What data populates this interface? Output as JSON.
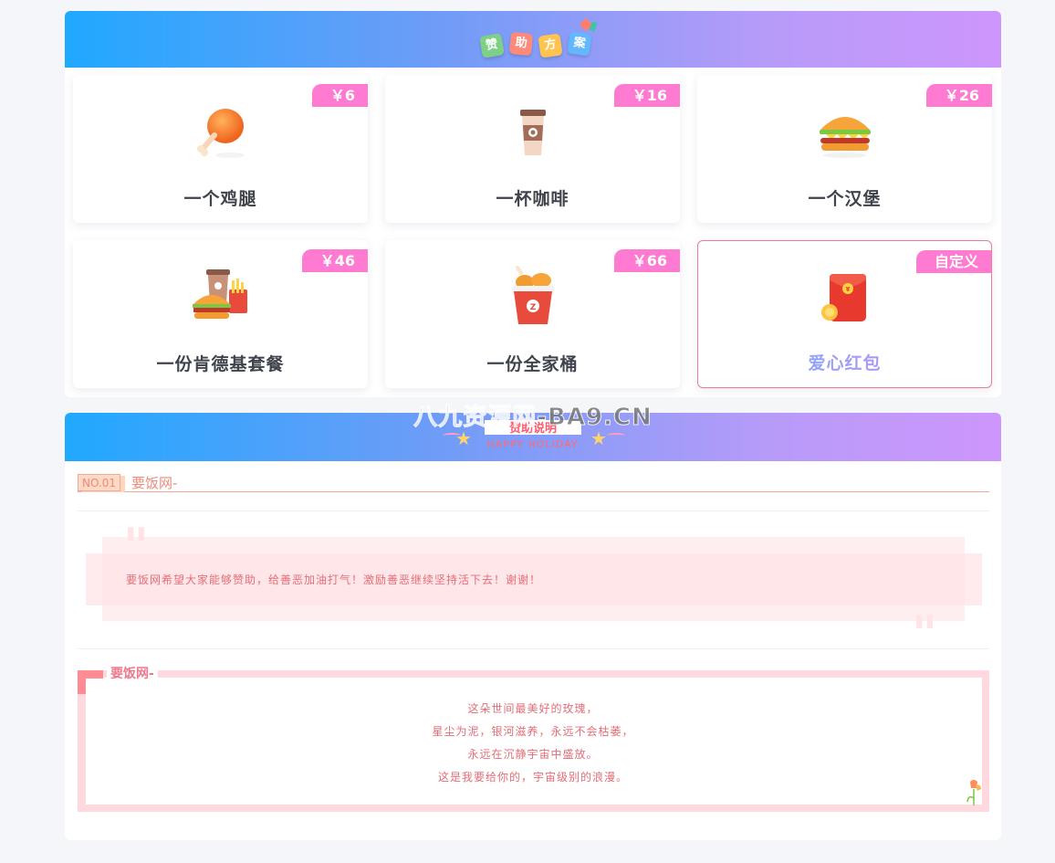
{
  "sponsor": {
    "title_chars": [
      "赞",
      "助",
      "方",
      "案"
    ],
    "cards": [
      {
        "price": "￥6",
        "label": "一个鸡腿",
        "icon": "chicken-leg-icon"
      },
      {
        "price": "￥16",
        "label": "一杯咖啡",
        "icon": "coffee-cup-icon"
      },
      {
        "price": "￥26",
        "label": "一个汉堡",
        "icon": "burger-icon"
      },
      {
        "price": "￥46",
        "label": "一份肯德基套餐",
        "icon": "combo-meal-icon"
      },
      {
        "price": "￥66",
        "label": "一份全家桶",
        "icon": "chicken-bucket-icon"
      },
      {
        "price": "自定义",
        "label": "爱心红包",
        "icon": "red-envelope-icon"
      }
    ]
  },
  "explain": {
    "watermark": "八九资源网-BA9.CN",
    "title": "赞助说明",
    "subtitle": "HAPPY HOLIDAY",
    "no_badge": "NO.01",
    "no_title": "要饭网-",
    "quote": "要饭网希望大家能够赞助，给善恶加油打气！激励善恶继续坚持活下去！谢谢！",
    "poem_title": "要饭网-",
    "poem_lines": [
      "这朵世间最美好的玫瑰，",
      "星尘为泥，银河滋养，永远不会枯萎，",
      "永远在沉静宇宙中盛放。",
      "这是我要给你的，宇宙级别的浪漫。"
    ]
  },
  "colors": {
    "header_gradient_start": "#20a8ff",
    "header_gradient_end": "#cd96fd",
    "price_tag": "#ff7ad1",
    "accent_pink": "#e46d76"
  }
}
